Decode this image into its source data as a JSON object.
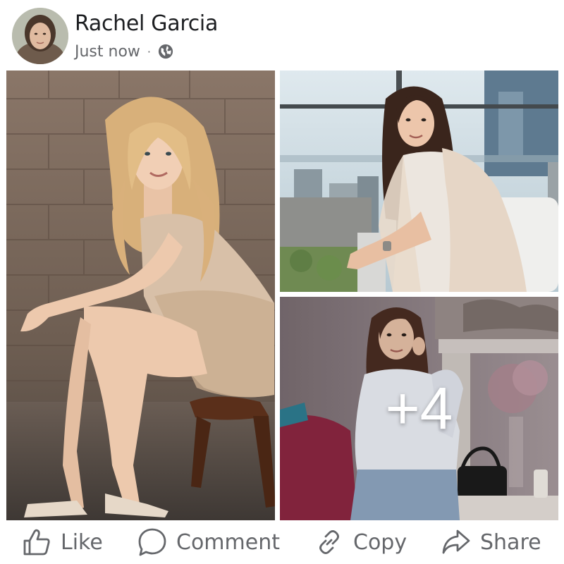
{
  "post": {
    "author": "Rachel Garcia",
    "timestamp": "Just now",
    "separator": "·",
    "audience_icon": "globe-icon"
  },
  "gallery": {
    "photo_count_visible": 3,
    "more_label": "+4"
  },
  "actions": {
    "like_label": "Like",
    "comment_label": "Comment",
    "copy_label": "Copy",
    "share_label": "Share"
  },
  "colors": {
    "text_primary": "#1c1e21",
    "text_secondary": "#65676b",
    "background": "#ffffff"
  }
}
